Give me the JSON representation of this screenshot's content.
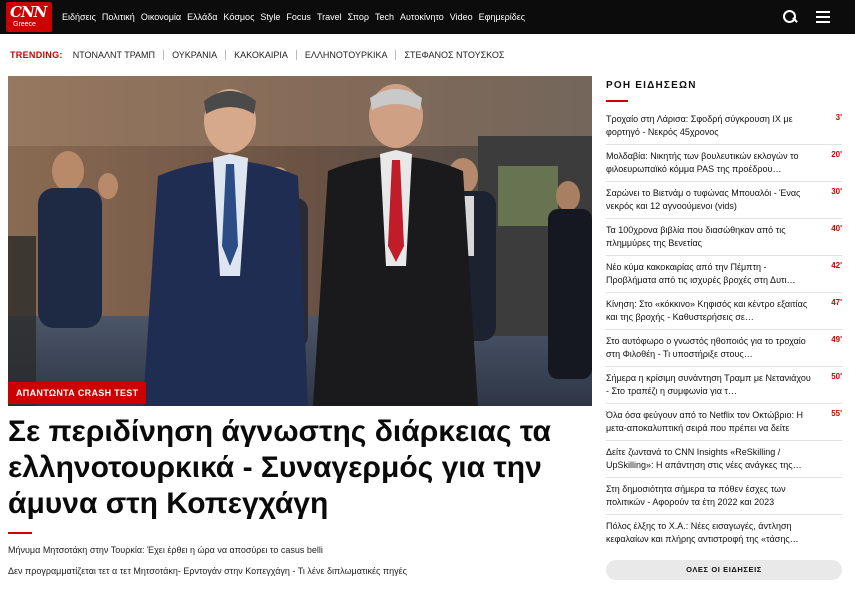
{
  "brand": {
    "logo_text": "CNN",
    "logo_sub": "Greece",
    "accent": "#cc0000"
  },
  "nav": [
    "Ειδήσεις",
    "Πολιτική",
    "Οικονομία",
    "Ελλάδα",
    "Κόσμος",
    "Style",
    "Focus",
    "Travel",
    "Σπορ",
    "Tech",
    "Αυτοκίνητο",
    "Video",
    "Εφημερίδες"
  ],
  "icons": {
    "search": "search-icon",
    "menu": "menu-icon"
  },
  "trending": {
    "label": "TRENDING:",
    "items": [
      "ΝΤΟΝΑΛΝΤ ΤΡΑΜΠ",
      "ΟΥΚΡΑΝΙΑ",
      "ΚΑΚΟΚΑΙΡΙΑ",
      "ΕΛΛΗΝΟΤΟΥΡΚΙΚΑ",
      "ΣΤΕΦΑΝΟΣ ΝΤΟΥΣΚΟΣ"
    ]
  },
  "hero": {
    "tag": "ΑΠΑΝΤΩΝΤΑ CRASH TEST",
    "headline": "Σε περιδίνηση άγνωστης διάρκειας τα ελληνοτουρκικά - Συναγερμός για την άμυνα στη Κοπεγχάγη",
    "related": [
      "Μήνυμα Μητσοτάκη στην Τουρκία: Έχει έρθει η ώρα να αποσύρει το casus belli",
      "Δεν προγραμματίζεται τετ α τετ Μητσοτάκη- Ερντογάν στην Κοπεγχάγη - Τι λένε διπλωματικές πηγές"
    ]
  },
  "sidebar": {
    "title": "ΡΟΗ ΕΙΔΗΣΕΩΝ",
    "items": [
      {
        "text": "Τροχαίο στη Λάρισα: Σφοδρή σύγκρουση ΙΧ με φορτηγό - Νεκρός 45χρονος",
        "time": "3'"
      },
      {
        "text": "Μολδαβία: Νικητής των βουλευτικών εκλογών το φιλοευρωπαϊκό κόμμα PAS της προέδρου…",
        "time": "20'"
      },
      {
        "text": "Σαρώνει το Βιετνάμ ο τυφώνας Μπουαλόι - Ένας νεκρός και 12 αγνοούμενοι (vids)",
        "time": "30'"
      },
      {
        "text": "Τα 100χρονα βιβλία που διασώθηκαν από τις πλημμύρες της Βενετίας",
        "time": "40'"
      },
      {
        "text": "Νέο κύμα κακοκαιρίας από την Πέμπτη - Προβλήματα από τις ισχυρές βροχές στη Δυτι…",
        "time": "42'"
      },
      {
        "text": "Κίνηση: Στο «κόκκινο» Κηφισός και κέντρο εξαιτίας και της βροχής - Καθυστερήσεις σε…",
        "time": "47'"
      },
      {
        "text": "Στο αυτόφωρο ο γνωστός ηθοποιός για το τροχαίο στη Φιλοθέη - Τι υποστήριξε στους…",
        "time": "49'"
      },
      {
        "text": "Σήμερα η κρίσιμη συνάντηση Τραμπ με Νετανιάχου - Στο τραπέζι η συμφωνία για τ…",
        "time": "50'"
      },
      {
        "text": "Όλα όσα φεύγουν από το Netflix τον Οκτώβριο: Η μετα-αποκαλυπτική σειρά που πρέπει να δείτε",
        "time": "55'"
      },
      {
        "text": "Δείτε ζωντανά το CNN Insights «ReSkilling / UpSkilling»: Η απάντηση στις νέες ανάγκες της…",
        "time": ""
      },
      {
        "text": "Στη δημοσιότητα σήμερα τα πόθεν έσχες των πολιτικών - Αφορούν τα έτη 2022 και 2023",
        "time": ""
      },
      {
        "text": "Πόλος έλξης το Χ.Α.: Νέες εισαγωγές, άντληση κεφαλαίων και πλήρης αντιστροφή της «τάσης…",
        "time": ""
      }
    ],
    "all_button": "ΟΛΕΣ ΟΙ ΕΙΔΗΣΕΙΣ"
  }
}
